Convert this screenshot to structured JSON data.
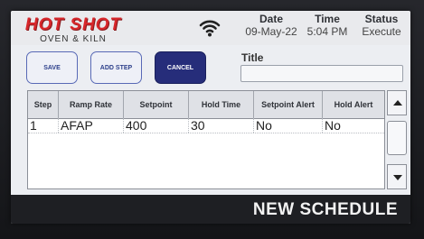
{
  "header": {
    "logo_main": "HOT SHOT",
    "logo_sub": "OVEN & KILN",
    "wifi_icon": "wifi-icon",
    "date_label": "Date",
    "date_value": "09-May-22",
    "time_label": "Time",
    "time_value": "5:04 PM",
    "status_label": "Status",
    "status_value": "Execute"
  },
  "toolbar": {
    "save_label": "SAVE",
    "add_step_label": "ADD STEP",
    "cancel_label": "CANCEL",
    "title_label": "Title",
    "title_value": ""
  },
  "table": {
    "columns": [
      "Step",
      "Ramp Rate",
      "Setpoint",
      "Hold Time",
      "Setpoint Alert",
      "Hold Alert"
    ],
    "rows": [
      {
        "step": "1",
        "ramp_rate": "AFAP",
        "setpoint": "400",
        "hold_time": "30",
        "setpoint_alert": "No",
        "hold_alert": "No"
      }
    ]
  },
  "scroll": {
    "up_icon": "scroll-up-arrow-icon",
    "down_icon": "scroll-down-arrow-icon"
  },
  "footer": {
    "screen_title": "NEW SCHEDULE"
  },
  "colors": {
    "brand_red": "#d7272b",
    "accent_blue": "#262d7a",
    "screen_bg": "#eceef2"
  }
}
